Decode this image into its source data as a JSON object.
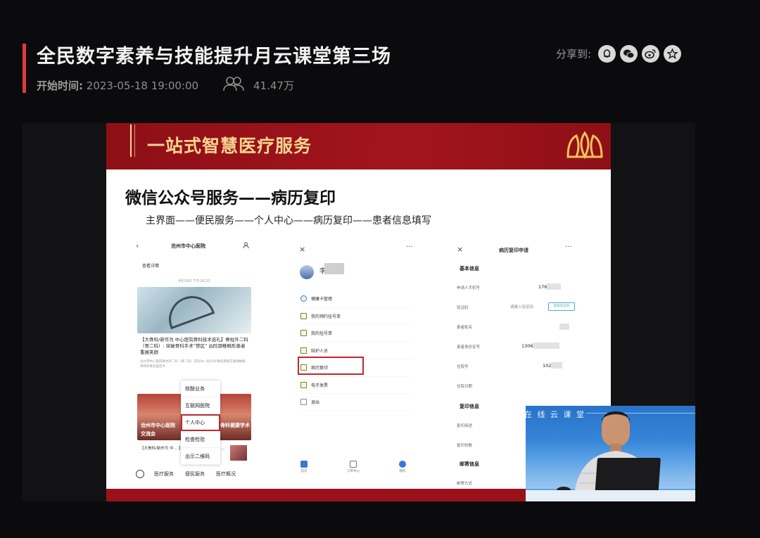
{
  "header": {
    "title": "全民数字素养与技能提升月云课堂第三场",
    "start_label": "开始时间:",
    "start_time": "2023-05-18 19:00:00",
    "viewer_count": "41.47万",
    "share_label": "分享到:",
    "share_icons": [
      "qq-icon",
      "wechat-icon",
      "weibo-icon",
      "qzone-icon"
    ]
  },
  "slide": {
    "banner": "一站式智慧医疗服务",
    "heading": "微信公众号服务——病历复印",
    "path": "主界面——便民服务——个人中心——病历复印——患者信息填写",
    "phone1": {
      "nav_title": "沧州市中心医院",
      "detail_link": "查看详情",
      "date": "4月19日 下午16:22",
      "news1_title": "【大骨科/新作为 中心医院骨科技术巡礼】脊柱外二科（骨二科）: 突破骨科手术“禁区”   凶险颈椎畸形患者重展笑颜",
      "news1_summary": "沧州市中心医院脊柱外二科（骨二科）成功为一名40岁重度患者实施颈椎截骨矫形联合固定术...",
      "img2_caption_left": "沧州市中心医院",
      "img2_caption_right": "骨科健康学术",
      "img2_caption_bottom": "交流会",
      "news2_title": "【大骨科/新作为 中... 】脊柱外三科（骨三科）...",
      "popup": [
        "核酸业务",
        "互联网医院",
        "个人中心",
        "检查检验",
        "出示二维码"
      ],
      "tabs": [
        "医疗服务",
        "便民服务",
        "医疗概况"
      ]
    },
    "phone2": {
      "user_name": "李",
      "menu": [
        "健康卡管理",
        "我的预约挂号单",
        "我的挂号单",
        "陪护人员",
        "病历复印",
        "电子发票",
        "退出"
      ],
      "tabs": [
        "首页",
        "订单中心",
        "我的"
      ]
    },
    "phone3": {
      "title": "病历复印申请",
      "sections": [
        "基本信息",
        "复印信息",
        "邮寄信息"
      ],
      "fields": [
        {
          "label": "申请人手机号",
          "value": "176          328"
        },
        {
          "label": "验证码",
          "value": "请输入验证码"
        },
        {
          "label": "患者姓名",
          "value": ""
        },
        {
          "label": "患者身份证号",
          "value": "1306                  010"
        },
        {
          "label": "住院号",
          "value": "102         918"
        },
        {
          "label": "住院日期",
          "value": ""
        },
        {
          "label": "复印用途",
          "value": ""
        },
        {
          "label": "复印份数",
          "value": ""
        },
        {
          "label": "邮寄方式",
          "value": ""
        }
      ],
      "code_button": "获取验证码"
    }
  },
  "webcam": {
    "banner": "在 线 云 课 堂"
  },
  "colors": {
    "accent_red": "#e23b3b",
    "slide_red": "#a3141d",
    "banner_gold": "#f6d48f",
    "highlight_red": "#c1272d"
  }
}
